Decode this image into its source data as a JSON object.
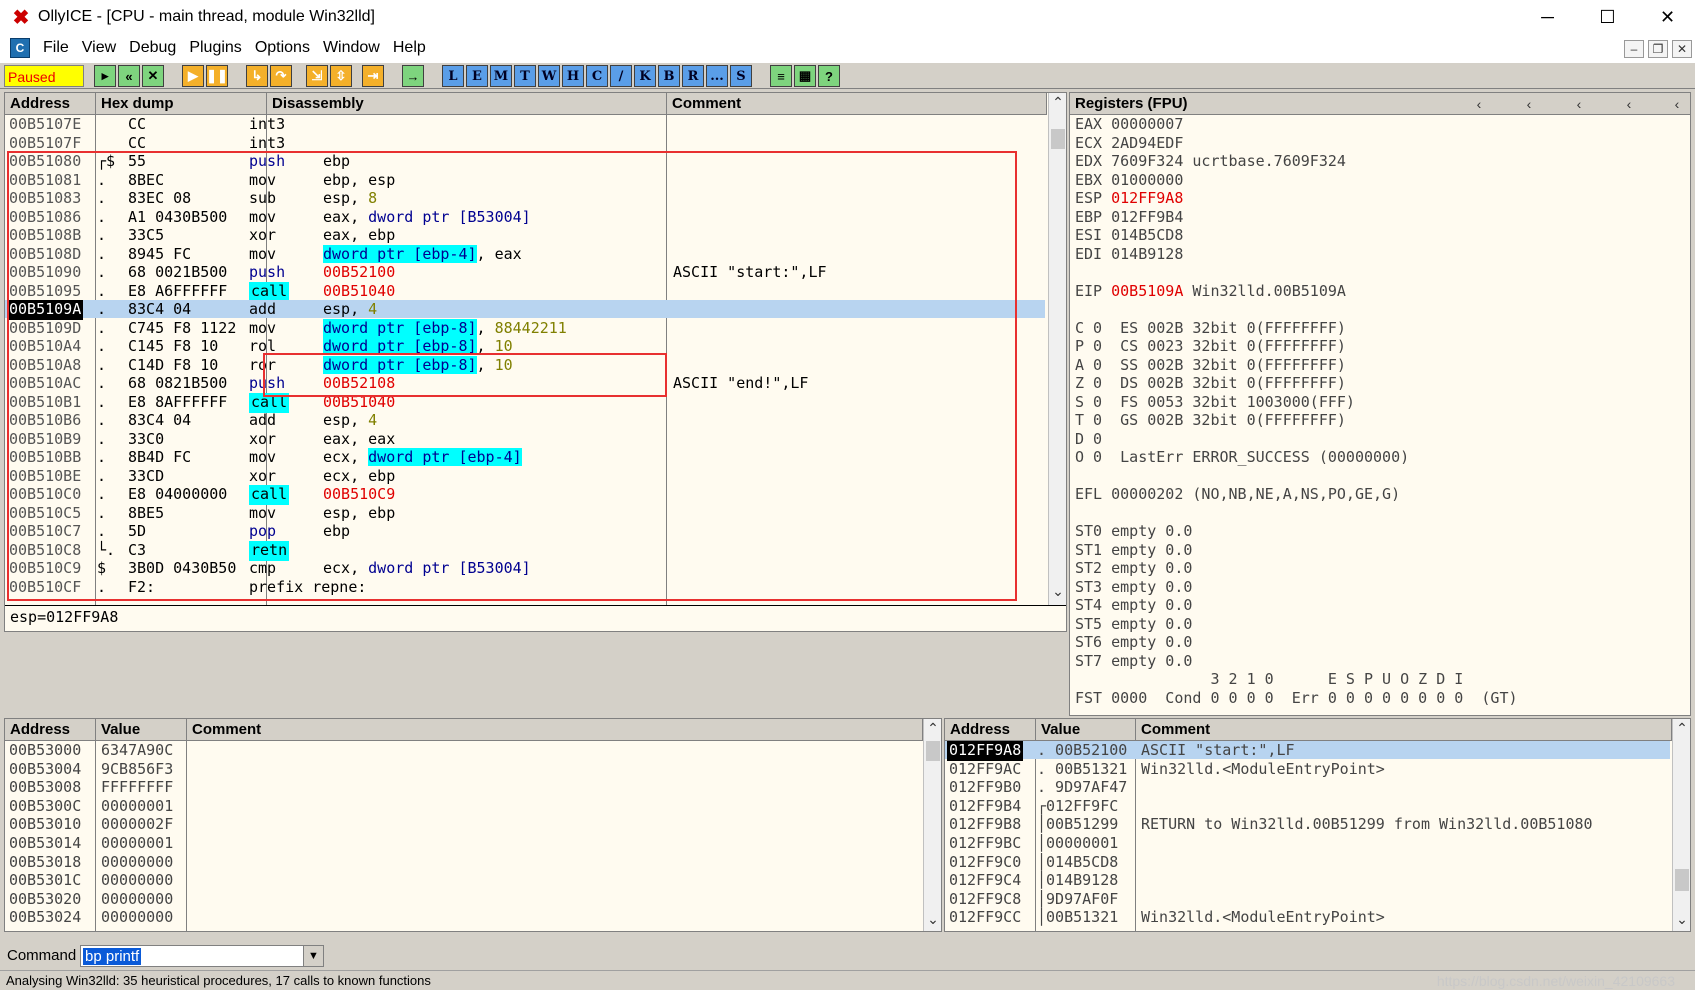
{
  "window": {
    "title": "OllyICE - [CPU - main thread, module Win32lld]",
    "status": "Paused"
  },
  "menu": [
    "File",
    "View",
    "Debug",
    "Plugins",
    "Options",
    "Window",
    "Help"
  ],
  "toolbar_letters": [
    "L",
    "E",
    "M",
    "T",
    "W",
    "H",
    "C",
    "/",
    "K",
    "B",
    "R",
    "...",
    "S"
  ],
  "disasm": {
    "headers": {
      "address": "Address",
      "hex": "Hex dump",
      "disasm": "Disassembly",
      "comment": "Comment"
    },
    "rows": [
      {
        "addr": "00B5107E",
        "m": "",
        "hex": "CC",
        "mn": "int3",
        "op": "",
        "cm": ""
      },
      {
        "addr": "00B5107F",
        "m": "",
        "hex": "CC",
        "mn": "int3",
        "op": "",
        "cm": ""
      },
      {
        "addr": "00B51080",
        "m": "┌$",
        "hex": "55",
        "mn": "push",
        "op": "ebp",
        "cm": ""
      },
      {
        "addr": "00B51081",
        "m": ".",
        "hex": "8BEC",
        "mn": "mov",
        "op": "ebp, esp",
        "cm": ""
      },
      {
        "addr": "00B51083",
        "m": ".",
        "hex": "83EC 08",
        "mn": "sub",
        "op": "esp, 8",
        "cm": ""
      },
      {
        "addr": "00B51086",
        "m": ".",
        "hex": "A1 0430B500",
        "mn": "mov",
        "op": "eax, dword ptr [B53004]",
        "cm": ""
      },
      {
        "addr": "00B5108B",
        "m": ".",
        "hex": "33C5",
        "mn": "xor",
        "op": "eax, ebp",
        "cm": ""
      },
      {
        "addr": "00B5108D",
        "m": ".",
        "hex": "8945 FC",
        "mn": "mov",
        "op": "dword ptr [ebp-4], eax",
        "cm": ""
      },
      {
        "addr": "00B51090",
        "m": ".",
        "hex": "68 0021B500",
        "mn": "push",
        "op": "00B52100",
        "cm": "ASCII \"start:\",LF"
      },
      {
        "addr": "00B51095",
        "m": ".",
        "hex": "E8 A6FFFFFF",
        "mn": "call",
        "op": "00B51040",
        "cm": ""
      },
      {
        "addr": "00B5109A",
        "m": ".",
        "hex": "83C4 04",
        "mn": "add",
        "op": "esp, 4",
        "cm": ""
      },
      {
        "addr": "00B5109D",
        "m": ".",
        "hex": "C745 F8 1122",
        "mn": "mov",
        "op": "dword ptr [ebp-8], 88442211",
        "cm": ""
      },
      {
        "addr": "00B510A4",
        "m": ".",
        "hex": "C145 F8 10",
        "mn": "rol",
        "op": "dword ptr [ebp-8], 10",
        "cm": ""
      },
      {
        "addr": "00B510A8",
        "m": ".",
        "hex": "C14D F8 10",
        "mn": "ror",
        "op": "dword ptr [ebp-8], 10",
        "cm": ""
      },
      {
        "addr": "00B510AC",
        "m": ".",
        "hex": "68 0821B500",
        "mn": "push",
        "op": "00B52108",
        "cm": "ASCII \"end!\",LF"
      },
      {
        "addr": "00B510B1",
        "m": ".",
        "hex": "E8 8AFFFFFF",
        "mn": "call",
        "op": "00B51040",
        "cm": ""
      },
      {
        "addr": "00B510B6",
        "m": ".",
        "hex": "83C4 04",
        "mn": "add",
        "op": "esp, 4",
        "cm": ""
      },
      {
        "addr": "00B510B9",
        "m": ".",
        "hex": "33C0",
        "mn": "xor",
        "op": "eax, eax",
        "cm": ""
      },
      {
        "addr": "00B510BB",
        "m": ".",
        "hex": "8B4D FC",
        "mn": "mov",
        "op": "ecx, dword ptr [ebp-4]",
        "cm": ""
      },
      {
        "addr": "00B510BE",
        "m": ".",
        "hex": "33CD",
        "mn": "xor",
        "op": "ecx, ebp",
        "cm": ""
      },
      {
        "addr": "00B510C0",
        "m": ".",
        "hex": "E8 04000000",
        "mn": "call",
        "op": "00B510C9",
        "cm": ""
      },
      {
        "addr": "00B510C5",
        "m": ".",
        "hex": "8BE5",
        "mn": "mov",
        "op": "esp, ebp",
        "cm": ""
      },
      {
        "addr": "00B510C7",
        "m": ".",
        "hex": "5D",
        "mn": "pop",
        "op": "ebp",
        "cm": ""
      },
      {
        "addr": "00B510C8",
        "m": "└.",
        "hex": "C3",
        "mn": "retn",
        "op": "",
        "cm": ""
      },
      {
        "addr": "00B510C9",
        "m": "$",
        "hex": "3B0D 0430B50",
        "mn": "cmp",
        "op": "ecx, dword ptr [B53004]",
        "cm": ""
      },
      {
        "addr": "00B510CF",
        "m": ".",
        "hex": "F2:",
        "mn": "prefix repne:",
        "op": "",
        "cm": ""
      }
    ],
    "info": "esp=012FF9A8"
  },
  "registers": {
    "title": "Registers (FPU)",
    "lines": [
      "EAX 00000007",
      "ECX 2AD94EDF",
      "EDX 7609F324 ucrtbase.7609F324",
      "EBX 01000000",
      "ESP 012FF9A8",
      "EBP 012FF9B4",
      "ESI 014B5CD8",
      "EDI 014B9128",
      "",
      "EIP 00B5109A Win32lld.00B5109A",
      "",
      "C 0  ES 002B 32bit 0(FFFFFFFF)",
      "P 0  CS 0023 32bit 0(FFFFFFFF)",
      "A 0  SS 002B 32bit 0(FFFFFFFF)",
      "Z 0  DS 002B 32bit 0(FFFFFFFF)",
      "S 0  FS 0053 32bit 1003000(FFF)",
      "T 0  GS 002B 32bit 0(FFFFFFFF)",
      "D 0",
      "O 0  LastErr ERROR_SUCCESS (00000000)",
      "",
      "EFL 00000202 (NO,NB,NE,A,NS,PO,GE,G)",
      "",
      "ST0 empty 0.0",
      "ST1 empty 0.0",
      "ST2 empty 0.0",
      "ST3 empty 0.0",
      "ST4 empty 0.0",
      "ST5 empty 0.0",
      "ST6 empty 0.0",
      "ST7 empty 0.0",
      "               3 2 1 0      E S P U O Z D I",
      "FST 0000  Cond 0 0 0 0  Err 0 0 0 0 0 0 0 0  (GT)"
    ]
  },
  "dump": {
    "headers": {
      "address": "Address",
      "value": "Value",
      "comment": "Comment"
    },
    "rows": [
      {
        "addr": "00B53000",
        "val": "6347A90C"
      },
      {
        "addr": "00B53004",
        "val": "9CB856F3"
      },
      {
        "addr": "00B53008",
        "val": "FFFFFFFF"
      },
      {
        "addr": "00B5300C",
        "val": "00000001"
      },
      {
        "addr": "00B53010",
        "val": "0000002F"
      },
      {
        "addr": "00B53014",
        "val": "00000001"
      },
      {
        "addr": "00B53018",
        "val": "00000000"
      },
      {
        "addr": "00B5301C",
        "val": "00000000"
      },
      {
        "addr": "00B53020",
        "val": "00000000"
      },
      {
        "addr": "00B53024",
        "val": "00000000"
      }
    ]
  },
  "stack": {
    "headers": {
      "address": "Address",
      "value": "Value",
      "comment": "Comment"
    },
    "rows": [
      {
        "addr": "012FF9A8",
        "val": ". 00B52100",
        "cm": "ASCII \"start:\",LF"
      },
      {
        "addr": "012FF9AC",
        "val": ". 00B51321",
        "cm": "Win32lld.<ModuleEntryPoint>"
      },
      {
        "addr": "012FF9B0",
        "val": ". 9D97AF47",
        "cm": ""
      },
      {
        "addr": "012FF9B4",
        "val": "┌012FF9FC",
        "cm": ""
      },
      {
        "addr": "012FF9B8",
        "val": "│00B51299",
        "cm": "RETURN to Win32lld.00B51299 from Win32lld.00B51080"
      },
      {
        "addr": "012FF9BC",
        "val": "│00000001",
        "cm": ""
      },
      {
        "addr": "012FF9C0",
        "val": "│014B5CD8",
        "cm": ""
      },
      {
        "addr": "012FF9C4",
        "val": "│014B9128",
        "cm": ""
      },
      {
        "addr": "012FF9C8",
        "val": "│9D97AF0F",
        "cm": ""
      },
      {
        "addr": "012FF9CC",
        "val": "│00B51321",
        "cm": "Win32lld.<ModuleEntryPoint>"
      }
    ]
  },
  "command": {
    "label": "Command",
    "value": "bp printf"
  },
  "statusbar": "Analysing Win32lld: 35 heuristical procedures, 17 calls to known functions",
  "watermark": "https://blog.csdn.net/weixin_42109663"
}
